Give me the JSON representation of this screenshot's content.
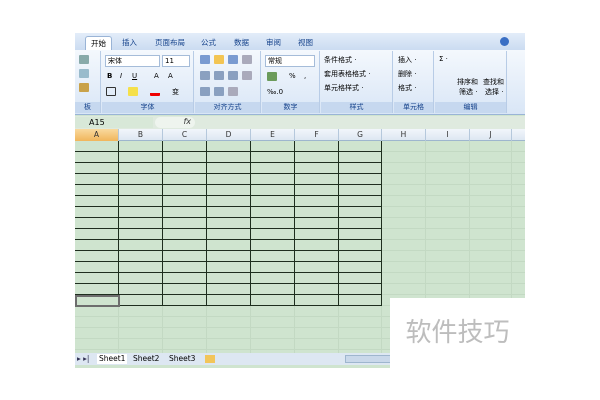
{
  "ribbon_tabs": [
    {
      "label": "开始",
      "active": true
    },
    {
      "label": "插入"
    },
    {
      "label": "页面布局"
    },
    {
      "label": "公式"
    },
    {
      "label": "数据"
    },
    {
      "label": "审阅"
    },
    {
      "label": "视图"
    }
  ],
  "groups": {
    "clipboard": "板",
    "font": "字体",
    "alignment": "对齐方式",
    "number": "数字",
    "styles": "样式",
    "cells": "单元格",
    "editing": "编辑"
  },
  "font": {
    "name": "宋体",
    "size": "11",
    "bold": "B",
    "italic": "I",
    "underline": "U",
    "grow": "A",
    "shrink": "A",
    "phonetic": "变"
  },
  "number": {
    "format": "常规",
    "percent": "%",
    "comma": ",",
    "decimals": "‰.0"
  },
  "styles": {
    "conditional": "条件格式 ·",
    "table": "套用表格格式 ·",
    "cell": "单元格样式 ·"
  },
  "cells": {
    "insert": "插入 ·",
    "delete": "删除 ·",
    "format": "格式 ·"
  },
  "editing": {
    "sum": "Σ ·",
    "sort": "排序和",
    "sort2": "筛选 ·",
    "find": "查找和",
    "find2": "选择 ·"
  },
  "formula_bar": {
    "name_box": "A15",
    "fx": "fx"
  },
  "columns": [
    "A",
    "B",
    "C",
    "D",
    "E",
    "F",
    "G",
    "H",
    "I",
    "J"
  ],
  "selected_column": "A",
  "sheets": [
    "Sheet1",
    "Sheet2",
    "Sheet3"
  ],
  "nav": "▸ ▸|",
  "watermark": "软件技巧"
}
